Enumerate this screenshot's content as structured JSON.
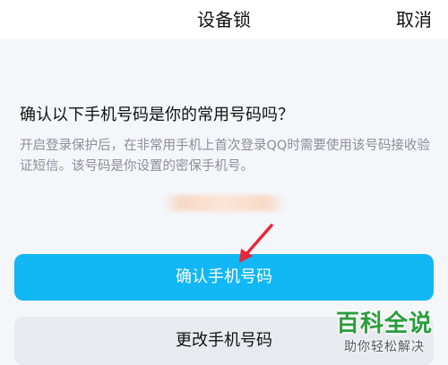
{
  "nav": {
    "title": "设备锁",
    "cancel_label": "取消"
  },
  "main": {
    "heading": "确认以下手机号码是你的常用号码吗？",
    "description": "开启登录保护后，在非常用手机上首次登录QQ时需要使用该号码接收验证短信。该号码是你设置的密保手机号。"
  },
  "buttons": {
    "confirm_label": "确认手机号码",
    "change_label": "更改手机号码"
  },
  "watermark": {
    "title": "百科全说",
    "subtitle": "助你轻松解决"
  },
  "colors": {
    "accent": "#12b7f5",
    "annotation_arrow": "#e8283a",
    "watermark_green": "#2a9d3c"
  }
}
